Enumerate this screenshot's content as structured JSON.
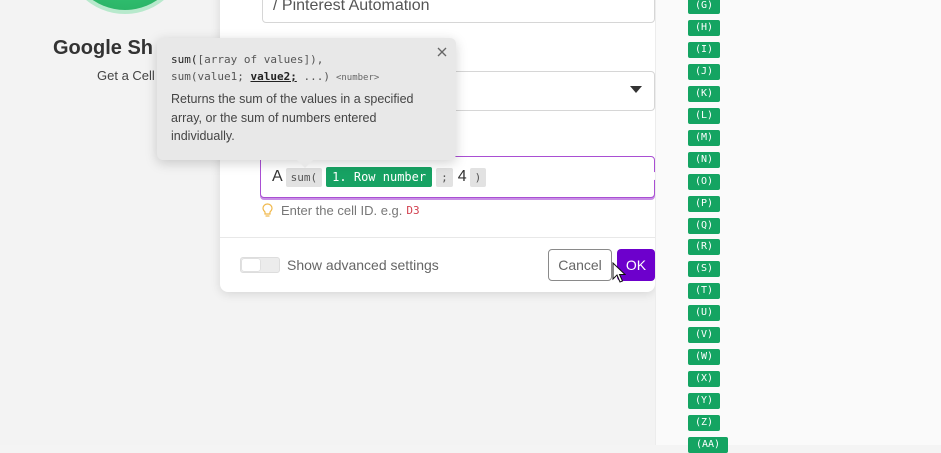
{
  "module": {
    "title": "Google Sh",
    "subtitle": "Get a Cell"
  },
  "dialog": {
    "name_value": "/ Pinterest Automation",
    "cell_field": {
      "label_letter": "A",
      "tokens": {
        "fn_open": "sum(",
        "variable": "1. Row number",
        "separator": ";",
        "number": "4",
        "fn_close": ")"
      }
    },
    "hint": {
      "text": "Enter the cell ID. e.g.",
      "example": "D3"
    },
    "advanced_label": "Show advanced settings",
    "cancel_label": "Cancel",
    "ok_label": "OK"
  },
  "tooltip": {
    "sig1_fn": "sum(",
    "sig1_args": "[array of values]),",
    "sig2_prefix": "sum(value1; ",
    "sig2_current": "value2;",
    "sig2_rest": " ...)",
    "sig2_return": "<number>",
    "description": "Returns the sum of the values in a specified array, or the sum of numbers entered individually."
  },
  "side_panel": {
    "tags": [
      "(G)",
      "(H)",
      "(I)",
      "(J)",
      "(K)",
      "(L)",
      "(M)",
      "(N)",
      "(O)",
      "(P)",
      "(Q)",
      "(R)",
      "(S)",
      "(T)",
      "(U)",
      "(V)",
      "(W)",
      "(X)",
      "(Y)",
      "(Z)",
      "(AA)"
    ]
  },
  "colors": {
    "accent": "#6d00cc",
    "variable_green": "#17a263",
    "field_focus": "#a94fd3"
  }
}
